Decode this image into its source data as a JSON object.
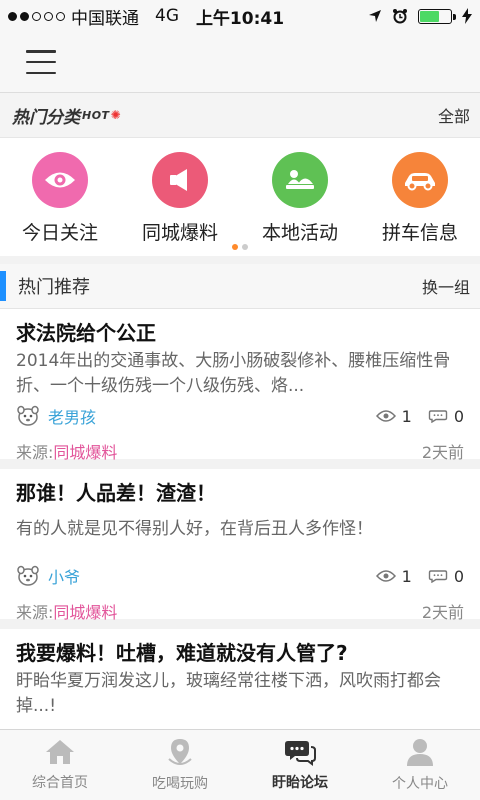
{
  "status_bar": {
    "carrier": "中国联通",
    "network": "4G",
    "time": "上午10:41"
  },
  "hot_categories": {
    "title": "热门分类",
    "hot_tag": "HOT",
    "all_label": "全部",
    "items": [
      {
        "label": "今日关注",
        "icon": "eye-icon",
        "color": "#f06aae"
      },
      {
        "label": "同城爆料",
        "icon": "megaphone-icon",
        "color": "#ec5a78"
      },
      {
        "label": "本地活动",
        "icon": "event-icon",
        "color": "#5fc154"
      },
      {
        "label": "拼车信息",
        "icon": "car-icon",
        "color": "#f6843a"
      }
    ]
  },
  "recommend": {
    "title": "热门推荐",
    "refresh_label": "换一组"
  },
  "posts": [
    {
      "title": "求法院给个公正",
      "excerpt": "2014年出的交通事故、大肠小肠破裂修补、腰椎压缩性骨折、一个十级伤残一个八级伤残、烙...",
      "author": "老男孩",
      "views": "1",
      "comments": "0",
      "source_label": "来源:",
      "source": "同城爆料",
      "time": "2天前"
    },
    {
      "title": "那谁！人品差！渣渣！",
      "excerpt": "有的人就是见不得别人好，在背后丑人多作怪！",
      "author": "小爷",
      "views": "1",
      "comments": "0",
      "source_label": "来源:",
      "source": "同城爆料",
      "time": "2天前"
    },
    {
      "title": "我要爆料！吐槽，难道就没有人管了?",
      "excerpt": "盱眙华夏万润发这儿，玻璃经常往楼下洒，风吹雨打都会掉...!"
    }
  ],
  "tabbar": [
    {
      "label": "综合首页",
      "icon": "home-icon",
      "active": false
    },
    {
      "label": "吃喝玩购",
      "icon": "location-pin-icon",
      "active": false
    },
    {
      "label": "盱眙论坛",
      "icon": "chat-bubbles-icon",
      "active": true
    },
    {
      "label": "个人中心",
      "icon": "user-icon",
      "active": false
    }
  ]
}
